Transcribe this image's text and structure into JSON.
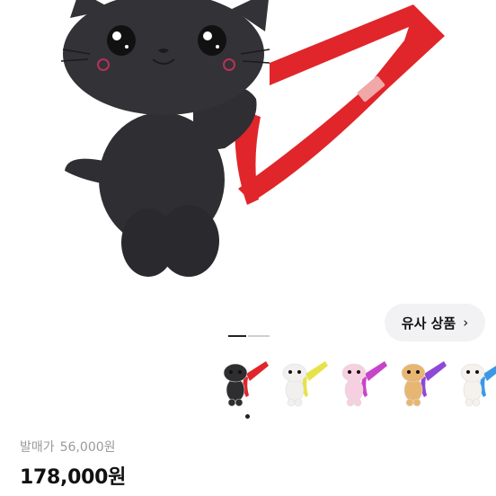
{
  "similar": {
    "label": "유사 상품",
    "chevron": "›"
  },
  "gallery": {
    "active_index": 1,
    "total": 2
  },
  "thumbnails": [
    {
      "name": "black-cat-plush",
      "body": "#2e2d30",
      "strap": "#e0262a"
    },
    {
      "name": "white-dog-plush",
      "body": "#f2f0ee",
      "strap": "#e6e34a"
    },
    {
      "name": "pink-mouse-plush",
      "body": "#f6cfe0",
      "strap": "#c744c8"
    },
    {
      "name": "orange-fox-plush",
      "body": "#e8b673",
      "strap": "#8e48d8"
    },
    {
      "name": "white-pudding-plush",
      "body": "#f5f1ec",
      "strap": "#3a98e8"
    }
  ],
  "price": {
    "original_label": "발매가",
    "original_value": "56,000원",
    "current": "178,000원"
  },
  "colors": {
    "strap": "#e0262a",
    "plush": "#2f2e32"
  }
}
